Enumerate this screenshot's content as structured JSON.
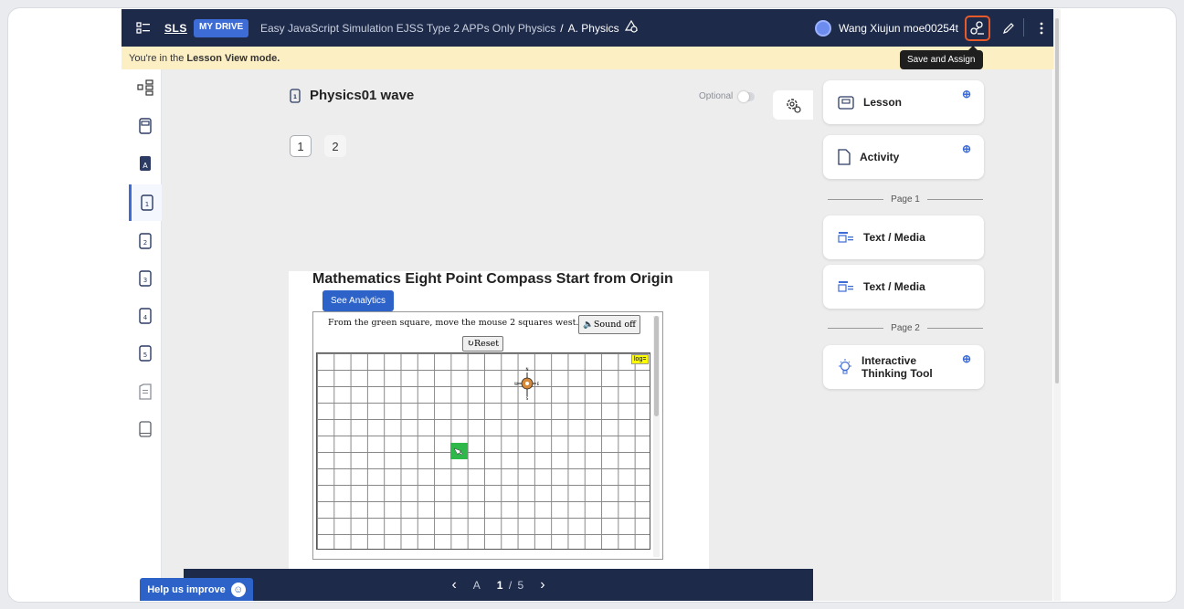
{
  "topbar": {
    "logo": "SLS",
    "mydrive": "MY DRIVE",
    "breadcrumb_parent": "Easy JavaScript Simulation EJSS Type 2 APPs Only Physics",
    "breadcrumb_sep": "/",
    "breadcrumb_current": "A. Physics",
    "user": "Wang Xiujun moe00254t"
  },
  "tooltip": "Save and Assign",
  "notice": {
    "prefix": "You're in the",
    "mode": "Lesson View mode."
  },
  "doc": {
    "title": "Physics01 wave",
    "optional_label": "Optional"
  },
  "pages": [
    "1",
    "2"
  ],
  "sim": {
    "title": "Mathematics Eight Point Compass Start from Origin",
    "analytics_label": "See Analytics",
    "instruction": "From the green square,   move the mouse 2 squares west.",
    "sound_label": "Sound off",
    "reset_label": "↻Reset",
    "log_label": "log="
  },
  "bottombar": {
    "prev": "‹",
    "section": "A",
    "current": "1",
    "sep": "/",
    "total": "5",
    "next": "›"
  },
  "help": {
    "label": "Help us improve"
  },
  "panel": {
    "lesson": "Lesson",
    "activity": "Activity",
    "page1": "Page 1",
    "text_media_1": "Text / Media",
    "text_media_2": "Text / Media",
    "page2": "Page 2",
    "itt_line1": "Interactive",
    "itt_line2": "Thinking Tool"
  },
  "colors": {
    "topbar": "#1d2a4a",
    "accent": "#3e6cd6",
    "notice": "#fdefc4",
    "highlight": "#e85a2a"
  }
}
